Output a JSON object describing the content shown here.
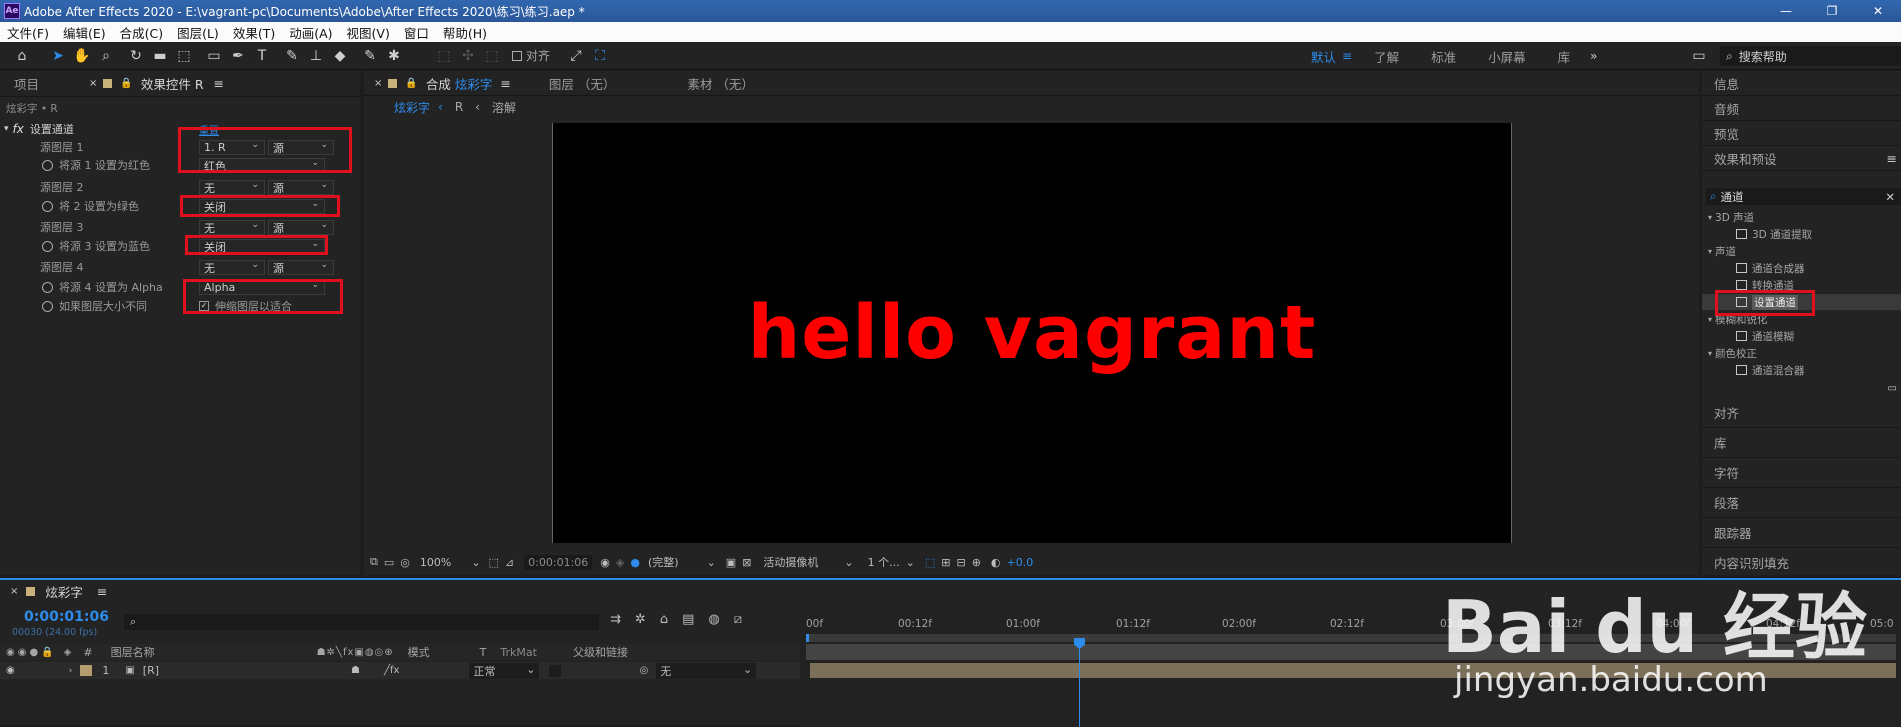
{
  "window": {
    "title": "Adobe After Effects 2020 - E:\\vagrant-pc\\Documents\\Adobe\\After Effects 2020\\练习\\练习.aep *",
    "logo": "Ae",
    "controls": [
      "—",
      "❐",
      "✕"
    ]
  },
  "menu": [
    "文件(F)",
    "编辑(E)",
    "合成(C)",
    "图层(L)",
    "效果(T)",
    "动画(A)",
    "视图(V)",
    "窗口",
    "帮助(H)"
  ],
  "toolbar": {
    "align_label": "对齐",
    "workspaces": [
      "默认",
      "了解",
      "标准",
      "小屏幕",
      "库"
    ],
    "workspace_active": "默认",
    "more": "»",
    "search_placeholder": "搜索帮助"
  },
  "left_panel": {
    "tabs": [
      "项目",
      "效果控件 R"
    ],
    "breadcrumb": "炫彩字 • R",
    "effect_name": "设置通道",
    "reset_label": "重置",
    "rows": [
      {
        "label": "源图层 1",
        "dd1": "1. R",
        "dd2": "源"
      },
      {
        "label": "将源 1 设置为红色",
        "dd1": "红色"
      },
      {
        "label": "源图层 2",
        "dd1": "无",
        "dd2": "源"
      },
      {
        "label": "将 2 设置为绿色",
        "dd1": "关闭"
      },
      {
        "label": "源图层 3",
        "dd1": "无",
        "dd2": "源"
      },
      {
        "label": "将源 3 设置为蓝色",
        "dd1": "关闭"
      },
      {
        "label": "源图层 4",
        "dd1": "无",
        "dd2": "源"
      },
      {
        "label": "将源 4 设置为 Alpha",
        "dd1": "Alpha"
      },
      {
        "label": "如果图层大小不同",
        "checkbox": "伸缩图层以适合"
      }
    ]
  },
  "comp_panel": {
    "tab_label": "合成",
    "tab_name": "炫彩字",
    "other_tabs": [
      "图层 （无）",
      "素材 （无）"
    ],
    "path": [
      "炫彩字",
      "R",
      "溶解"
    ],
    "canvas_text": "hello vagrant",
    "canvas_text_color": "#ff0000",
    "footer": {
      "zoom": "100%",
      "timecode": "0:00:01:06",
      "quality": "(完整)",
      "camera": "活动摄像机",
      "views": "1 个...",
      "exposure": "+0.0"
    }
  },
  "right_panel": {
    "top_items": [
      "信息",
      "音频",
      "预览",
      "效果和预设"
    ],
    "search_value": "通道",
    "tree": [
      {
        "type": "folder",
        "label": "3D 声道"
      },
      {
        "type": "effect",
        "label": "3D 通道提取"
      },
      {
        "type": "folder",
        "label": "声道"
      },
      {
        "type": "effect",
        "label": "通道合成器"
      },
      {
        "type": "effect",
        "label": "转换通道"
      },
      {
        "type": "effect",
        "label": "设置通道",
        "selected": true
      },
      {
        "type": "folder",
        "label": "模糊和锐化"
      },
      {
        "type": "effect",
        "label": "通道模糊"
      },
      {
        "type": "folder",
        "label": "颜色校正"
      },
      {
        "type": "effect",
        "label": "通道混合器"
      }
    ],
    "bottom_items": [
      "对齐",
      "库",
      "字符",
      "段落",
      "跟踪器",
      "内容识别填充"
    ]
  },
  "timeline": {
    "comp_name": "炫彩字",
    "timecode": "0:00:01:06",
    "frame_info": "00030 (24.00 fps)",
    "search_placeholder": "",
    "columns": {
      "num": "#",
      "name": "图层名称",
      "mode": "模式",
      "t": "T",
      "trkmat": "TrkMat",
      "parent": "父级和链接"
    },
    "ruler": [
      "00f",
      "00:12f",
      "01:00f",
      "01:12f",
      "02:00f",
      "02:12f",
      "03:00f",
      "03:12f",
      "04:00f",
      "04:12f",
      "05:0"
    ],
    "layer": {
      "num": "1",
      "name": "[R]",
      "mode": "正常",
      "parent": "无"
    }
  },
  "watermark": {
    "brand": "Bai du 经验",
    "url": "jingyan.baidu.com"
  }
}
